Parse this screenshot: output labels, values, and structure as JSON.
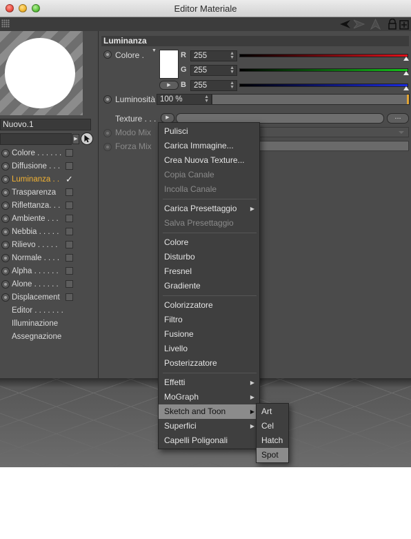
{
  "window": {
    "title": "Editor Materiale"
  },
  "left_panel": {
    "material_name": "Nuovo.1",
    "channels": [
      {
        "label": "Colore . . . . . .",
        "checked": false,
        "active": false
      },
      {
        "label": "Diffusione . . .",
        "checked": false,
        "active": false
      },
      {
        "label": "Luminanza . .",
        "checked": true,
        "active": true
      },
      {
        "label": "Trasparenza",
        "checked": false,
        "active": false
      },
      {
        "label": "Riflettanza. . .",
        "checked": false,
        "active": false
      },
      {
        "label": "Ambiente . . .",
        "checked": false,
        "active": false
      },
      {
        "label": "Nebbia . . . . .",
        "checked": false,
        "active": false
      },
      {
        "label": "Rilievo . . . . .",
        "checked": false,
        "active": false
      },
      {
        "label": "Normale . . . .",
        "checked": false,
        "active": false
      },
      {
        "label": "Alpha . . . . . .",
        "checked": false,
        "active": false
      },
      {
        "label": "Alone . . . . . .",
        "checked": false,
        "active": false
      },
      {
        "label": "Displacement",
        "checked": false,
        "active": false
      }
    ],
    "extra_items": [
      "Editor . . . . . . .",
      "Illuminazione",
      "Assegnazione"
    ],
    "check_glyph": "✓"
  },
  "luminanza": {
    "header": "Luminanza",
    "color_label": "Colore .",
    "r_label": "R",
    "g_label": "G",
    "b_label": "B",
    "r_value": "255",
    "g_value": "255",
    "b_value": "255",
    "luminosity_label": "Luminosità",
    "luminosity_value": "100 %",
    "texture_label": "Texture . . .",
    "texture_button": "...",
    "mix_mode_label": "Modo Mix",
    "mix_strength_label": "Forza Mix",
    "colors": {
      "r": "#e0101a",
      "g": "#15c21a",
      "b": "#1a2ae0",
      "accent": "#f2b233"
    }
  },
  "context_menu": {
    "groups": [
      [
        {
          "label": "Pulisci",
          "disabled": false,
          "submenu": false
        },
        {
          "label": "Carica Immagine...",
          "disabled": false,
          "submenu": false
        },
        {
          "label": "Crea Nuova Texture...",
          "disabled": false,
          "submenu": false
        },
        {
          "label": "Copia Canale",
          "disabled": true,
          "submenu": false
        },
        {
          "label": "Incolla Canale",
          "disabled": true,
          "submenu": false
        }
      ],
      [
        {
          "label": "Carica Presettaggio",
          "disabled": false,
          "submenu": true
        },
        {
          "label": "Salva Presettaggio",
          "disabled": true,
          "submenu": false
        }
      ],
      [
        {
          "label": "Colore",
          "disabled": false,
          "submenu": false
        },
        {
          "label": "Disturbo",
          "disabled": false,
          "submenu": false
        },
        {
          "label": "Fresnel",
          "disabled": false,
          "submenu": false
        },
        {
          "label": "Gradiente",
          "disabled": false,
          "submenu": false
        }
      ],
      [
        {
          "label": "Colorizzatore",
          "disabled": false,
          "submenu": false
        },
        {
          "label": "Filtro",
          "disabled": false,
          "submenu": false
        },
        {
          "label": "Fusione",
          "disabled": false,
          "submenu": false
        },
        {
          "label": "Livello",
          "disabled": false,
          "submenu": false
        },
        {
          "label": "Posterizzatore",
          "disabled": false,
          "submenu": false
        }
      ],
      [
        {
          "label": "Effetti",
          "disabled": false,
          "submenu": true
        },
        {
          "label": "MoGraph",
          "disabled": false,
          "submenu": true
        },
        {
          "label": "Sketch and Toon",
          "disabled": false,
          "submenu": true,
          "highlighted": true
        },
        {
          "label": "Superfici",
          "disabled": false,
          "submenu": true
        },
        {
          "label": "Capelli Poligonali",
          "disabled": false,
          "submenu": false
        }
      ]
    ],
    "submenu_glyph": "▶"
  },
  "sketch_submenu": {
    "items": [
      "Art",
      "Cel",
      "Hatch",
      "Spot"
    ],
    "highlighted": "Spot"
  },
  "icons": [
    "close-light",
    "minimize-light",
    "zoom-light",
    "grip-icon",
    "back-arrow-icon",
    "forward-arrow-icon",
    "up-arrow-icon",
    "lock-icon",
    "new-window-icon",
    "cursor-icon"
  ]
}
